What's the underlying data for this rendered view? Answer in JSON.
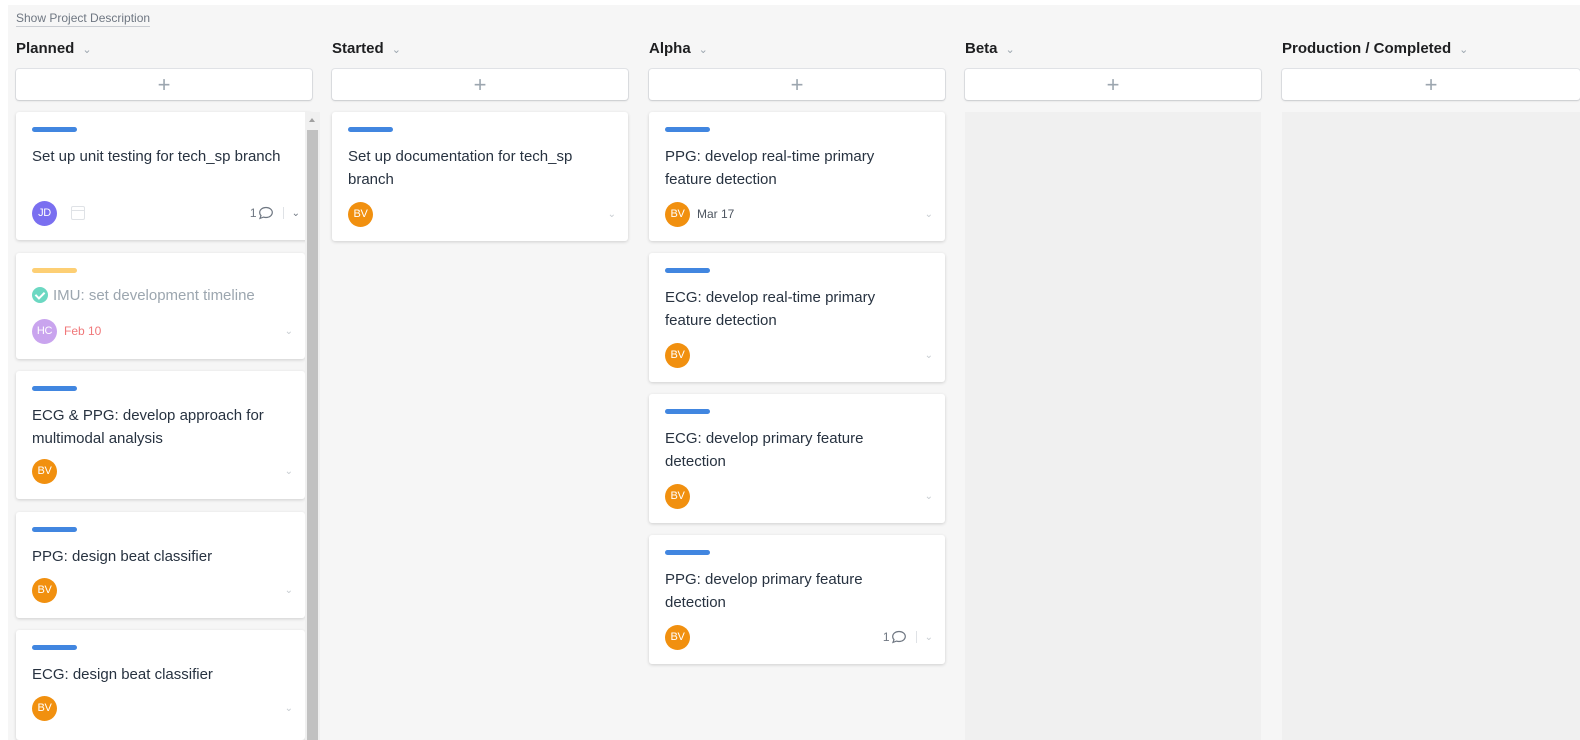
{
  "board": {
    "show_description": "Show Project Description",
    "add_symbol": "+",
    "columns": [
      {
        "name": "Planned",
        "cards": [
          {
            "title": "Set up unit testing for tech_sp branch",
            "bar": "blue",
            "assignee": "JD",
            "avatar_color": "#7a6ff0",
            "due": "",
            "comments": "1",
            "completed": false
          },
          {
            "title": "IMU: set development timeline",
            "bar": "yellow",
            "assignee": "HC",
            "avatar_color": "#c9a4ee",
            "due": "Feb 10",
            "comments": "",
            "completed": true
          },
          {
            "title": "ECG & PPG: develop approach for multimodal analysis",
            "bar": "blue",
            "assignee": "BV",
            "avatar_color": "#f1900f",
            "due": "",
            "comments": "",
            "completed": false
          },
          {
            "title": "PPG: design beat classifier",
            "bar": "blue",
            "assignee": "BV",
            "avatar_color": "#f1900f",
            "due": "",
            "comments": "",
            "completed": false
          },
          {
            "title": "ECG: design beat classifier",
            "bar": "blue",
            "assignee": "BV",
            "avatar_color": "#f1900f",
            "due": "",
            "comments": "",
            "completed": false
          }
        ]
      },
      {
        "name": "Started",
        "cards": [
          {
            "title": "Set up documentation for tech_sp branch",
            "bar": "blue",
            "assignee": "BV",
            "avatar_color": "#f1900f",
            "due": "",
            "comments": "",
            "completed": false
          }
        ]
      },
      {
        "name": "Alpha",
        "cards": [
          {
            "title": "PPG: develop real-time primary feature detection",
            "bar": "blue",
            "assignee": "BV",
            "avatar_color": "#f1900f",
            "due": "Mar 17",
            "comments": "",
            "completed": false
          },
          {
            "title": "ECG: develop real-time primary feature detection",
            "bar": "blue",
            "assignee": "BV",
            "avatar_color": "#f1900f",
            "due": "",
            "comments": "",
            "completed": false
          },
          {
            "title": "ECG: develop primary feature detection",
            "bar": "blue",
            "assignee": "BV",
            "avatar_color": "#f1900f",
            "due": "",
            "comments": "",
            "completed": false
          },
          {
            "title": "PPG: develop primary feature detection",
            "bar": "blue",
            "assignee": "BV",
            "avatar_color": "#f1900f",
            "due": "",
            "comments": "1",
            "completed": false
          }
        ]
      },
      {
        "name": "Beta",
        "cards": []
      },
      {
        "name": "Production / Completed",
        "cards": []
      }
    ]
  },
  "colors": {
    "bar_blue": "#4186e0",
    "bar_yellow": "#fdcf74",
    "completed_check": "#6cd8c2",
    "due_overdue": "#f0787a"
  },
  "icons": {
    "column_menu": "chevron-down-icon",
    "add": "plus-icon",
    "comment": "comment-bubble-icon",
    "card_menu": "chevron-down-icon",
    "due_date": "calendar-icon",
    "complete": "check-circle-icon"
  }
}
